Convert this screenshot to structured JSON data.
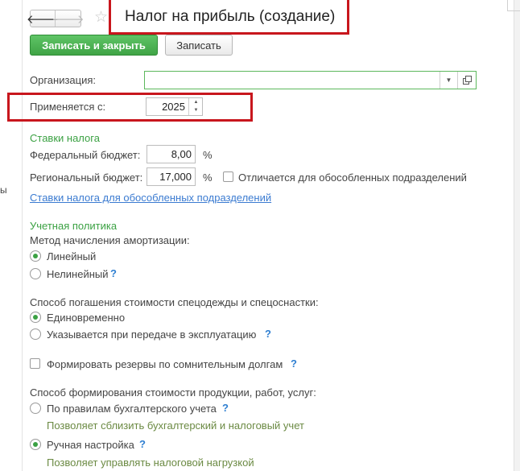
{
  "window": {
    "title": "Налог на прибыль (создание)",
    "side_fragment": "ы"
  },
  "nav": {
    "back_glyph": "🡐",
    "forward_glyph": "🡒",
    "star_glyph": "☆"
  },
  "toolbar": {
    "save_close_label": "Записать и закрыть",
    "save_label": "Записать"
  },
  "organization": {
    "label": "Организация:",
    "value": "",
    "dropdown_glyph": "▼"
  },
  "applies_from": {
    "label": "Применяется с:",
    "value": "2025",
    "spin_up": "▲",
    "spin_down": "▼"
  },
  "tax_rates": {
    "title": "Ставки налога",
    "federal_label": "Федеральный бюджет:",
    "federal_value": "8,00",
    "regional_label": "Региональный бюджет:",
    "regional_value": "17,000",
    "percent": "%",
    "separate_label": "Отличается для обособленных подразделений",
    "separate_checked": false,
    "link_label": "Ставки налога для обособленных подразделений"
  },
  "accounting_policy": {
    "title": "Учетная политика",
    "depreciation": {
      "label": "Метод начисления амортизации:",
      "options": [
        {
          "label": "Линейный",
          "checked": true,
          "help": false
        },
        {
          "label": "Нелинейный",
          "checked": false,
          "help": true
        }
      ]
    },
    "workwear": {
      "label": "Способ погашения стоимости спецодежды и спецоснастки:",
      "options": [
        {
          "label": "Единовременно",
          "checked": true,
          "help": false
        },
        {
          "label": "Указывается при передаче в эксплуатацию",
          "checked": false,
          "help": true
        }
      ]
    },
    "reserves": {
      "label": "Формировать резервы по сомнительным долгам",
      "checked": false
    },
    "cost_formation": {
      "label": "Способ формирования стоимости продукции, работ, услуг:",
      "options": [
        {
          "label": "По правилам бухгалтерского учета",
          "checked": false,
          "help": true,
          "hint": "Позволяет сблизить бухгалтерский и налоговый учет"
        },
        {
          "label": "Ручная настройка",
          "checked": true,
          "help": true,
          "hint": "Позволяет управлять налоговой нагрузкой"
        }
      ]
    },
    "help_glyph": "?"
  },
  "colors": {
    "accent_green": "#3ba143",
    "button_green": "#4cb553",
    "highlight_red": "#c8161d",
    "link_blue": "#3b7bd1"
  }
}
